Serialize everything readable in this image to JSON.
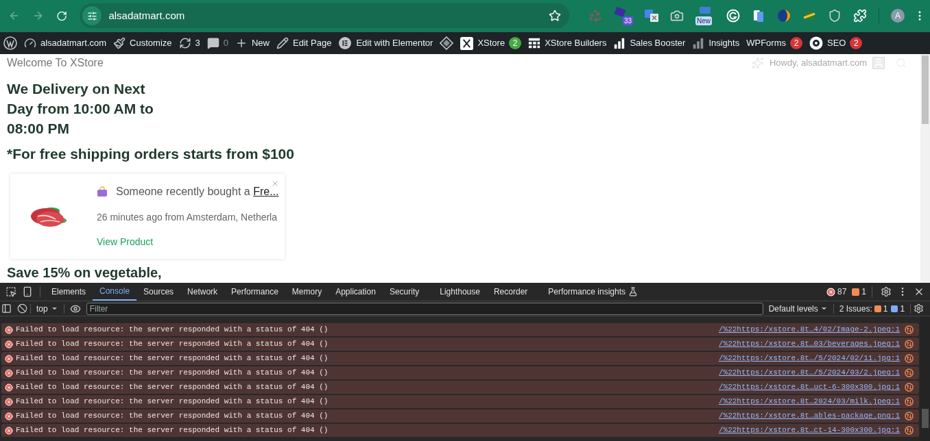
{
  "browser": {
    "back_disabled": true,
    "forward_disabled": true,
    "url": "alsadatmart.com",
    "extension_badges": [
      "33",
      "New"
    ],
    "avatar": "A"
  },
  "admin_bar": [
    {
      "kind": "wp"
    },
    {
      "kind": "site",
      "label": "alsadatmart.com"
    },
    {
      "kind": "customize",
      "label": "Customize"
    },
    {
      "kind": "updates",
      "label": "3"
    },
    {
      "kind": "comments",
      "label": "0"
    },
    {
      "kind": "new",
      "label": "New"
    },
    {
      "kind": "edit",
      "label": "Edit Page"
    },
    {
      "kind": "elementor",
      "label": "Edit with Elementor"
    },
    {
      "kind": "diamond"
    },
    {
      "kind": "xstore",
      "label": "XStore",
      "badge": "2",
      "color": "#46a843"
    },
    {
      "kind": "builders",
      "label": "XStore Builders"
    },
    {
      "kind": "booster",
      "label": "Sales Booster"
    },
    {
      "kind": "insights",
      "label": "Insights"
    },
    {
      "kind": "plain",
      "label": "WPForms",
      "badge": "2",
      "color": "#d63638"
    },
    {
      "kind": "seo",
      "label": "SEO",
      "badge": "2",
      "color": "#d63638"
    }
  ],
  "page": {
    "welcome": "Welcome To XStore",
    "howdy": "Howdy, alsadatmart.com",
    "delivery_lines": [
      "We Delivery on Next",
      "Day from 10:00 AM to",
      "08:00 PM"
    ],
    "shipping": "*For free shipping orders starts from $100",
    "save": "Save 15% on vegetable,"
  },
  "popup": {
    "text": "Someone recently bought a ",
    "product_link": "Fre...",
    "time": "26 minutes ago from Amsterdam, Netherla",
    "cta": "View Product"
  },
  "devtools": {
    "tabs": [
      {
        "label": "Elements",
        "selected": false
      },
      {
        "label": "Console",
        "selected": true
      },
      {
        "label": "Sources",
        "selected": false
      },
      {
        "label": "Network",
        "selected": false
      },
      {
        "label": "Performance",
        "selected": false
      },
      {
        "label": "Memory",
        "selected": false
      },
      {
        "label": "Application",
        "selected": false
      },
      {
        "label": "Security",
        "selected": false
      },
      {
        "label": "Lighthouse",
        "selected": false
      },
      {
        "label": "Recorder",
        "selected": false
      },
      {
        "label": "Performance insights",
        "selected": false
      }
    ],
    "error_count": "87",
    "warning_count": "1",
    "context": "top",
    "filter_placeholder": "Filter",
    "levels": "Default levels",
    "issues_label": "2 Issues:",
    "issues_warning": "1",
    "issues_info": "1",
    "messages": [
      {
        "text": "Failed to load resource: the server responded with a status of 404 ()",
        "source": "/%22https:/xstore.8t…4/02/Image-2.jpeg:1"
      },
      {
        "text": "Failed to load resource: the server responded with a status of 404 ()",
        "source": "/%22https:/xstore.8t…03/beverages.jpeg:1"
      },
      {
        "text": "Failed to load resource: the server responded with a status of 404 ()",
        "source": "/%22https:/xstore.8t…/5/2024/02/11.jpg:1"
      },
      {
        "text": "Failed to load resource: the server responded with a status of 404 ()",
        "source": "/%22https:/xstore.8t…/5/2024/03/2.jpeg:1"
      },
      {
        "text": "Failed to load resource: the server responded with a status of 404 ()",
        "source": "/%22https:/xstore.8t…uct-6-300x300.jpg:1"
      },
      {
        "text": "Failed to load resource: the server responded with a status of 404 ()",
        "source": "/%22https:/xstore.8t…2024/03/milk.jpeg:1"
      },
      {
        "text": "Failed to load resource: the server responded with a status of 404 ()",
        "source": "/%22https:/xstore.8t…ables-package.png:1"
      },
      {
        "text": "Failed to load resource: the server responded with a status of 404 ()",
        "source": "/%22https:/xstore.8t…ct-14-300x300.jpg:1"
      }
    ]
  }
}
